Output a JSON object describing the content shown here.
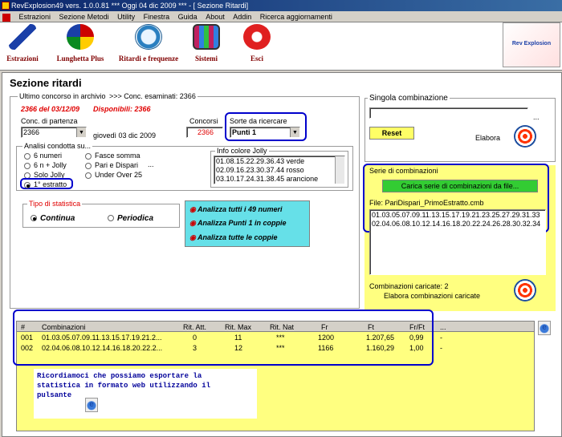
{
  "window": {
    "title": "RevExplosion49 vers. 1.0.0.81 *** Oggi 04 dic 2009 *** - [ Sezione Ritardi]"
  },
  "menu": [
    "Estrazioni",
    "Sezione Metodi",
    "Utility",
    "Finestra",
    "Guida",
    "About",
    "Addin",
    "Ricerca aggiornamenti"
  ],
  "toolbar": {
    "items": [
      {
        "label": "Estrazioni",
        "icon": "pencil-icon"
      },
      {
        "label": "Lunghetta Plus",
        "icon": "color-wheel-icon"
      },
      {
        "label": "Ritardi e frequenze",
        "icon": "clock-icon"
      },
      {
        "label": "Sistemi",
        "icon": "grid-icon"
      },
      {
        "label": "Esci",
        "icon": "power-icon"
      }
    ],
    "logo_text": "Rev Explosion"
  },
  "section_title": "Sezione ritardi",
  "ultimo": {
    "label": "Ultimo concorso in archivio",
    "examined": ">>> Conc. esaminati: 2366",
    "value": "2366 del 03/12/09",
    "available": "Disponibili: 2366"
  },
  "conc_partenza": {
    "label": "Conc. di partenza",
    "value": "2366",
    "date": "giovedì 03 dic 2009"
  },
  "concorsi": {
    "label": "Concorsi",
    "value": "2366"
  },
  "sorte": {
    "label": "Sorte da ricercare",
    "value": "Punti 1"
  },
  "analisi": {
    "label": "Analisi condotta su...",
    "options_left": [
      "6 numeri",
      "6 n + Jolly",
      "Solo Jolly",
      "1° estratto"
    ],
    "options_right": [
      "Fasce somma",
      "Pari e Dispari",
      "Under Over 25"
    ],
    "extra": "...",
    "selected": "1° estratto"
  },
  "info_jolly": {
    "label": "Info colore Jolly",
    "lines": [
      "01.08.15.22.29.36.43 verde",
      "02.09.16.23.30.37.44 rosso",
      "03.10.17.24.31.38.45 arancione"
    ]
  },
  "tipo": {
    "label": "Tipo di statistica",
    "options": [
      "Continua",
      "Periodica"
    ],
    "selected": "Continua"
  },
  "analizza": [
    "Analizza tutti i 49 numeri",
    "Analizza Punti 1 in coppie",
    "Analizza tutte le coppie"
  ],
  "singola": {
    "label": "Singola combinazione",
    "value": "",
    "ellipsis": "...",
    "reset": "Reset",
    "elabora": "Elabora"
  },
  "serie": {
    "label": "Serie di combinazioni",
    "load_button": "Carica serie di combinazioni da file...",
    "file": "File: PariDispari_PrimoEstratto.cmb",
    "lines": [
      "01.03.05.07.09.11.13.15.17.19.21.23.25.27.29.31.33",
      "02.04.06.08.10.12.14.16.18.20.22.24.26.28.30.32.34"
    ],
    "loaded": "Combinazioni caricate: 2",
    "elabora": "Elabora combinazioni caricate"
  },
  "table": {
    "headers": [
      "#",
      "Combinazioni",
      "Rit. Att.",
      "Rit. Max",
      "Rit. Nat",
      "Fr",
      "Ft",
      "Fr/Ft",
      "..."
    ],
    "rows": [
      [
        "001",
        "01.03.05.07.09.11.13.15.17.19.21.2...",
        "0",
        "11",
        "***",
        "1200",
        "1.207,65",
        "0,99",
        "-"
      ],
      [
        "002",
        "02.04.06.08.10.12.14.16.18.20.22.2...",
        "3",
        "12",
        "***",
        "1166",
        "1.160,29",
        "1,00",
        "-"
      ]
    ]
  },
  "note": "Ricordiamoci che possiamo esportare la statistica in formato web utilizzando il pulsante",
  "colors": {
    "accent_blue": "#0000cc",
    "yellow": "#ffff66",
    "red": "#e00000",
    "green": "#33cc33"
  }
}
